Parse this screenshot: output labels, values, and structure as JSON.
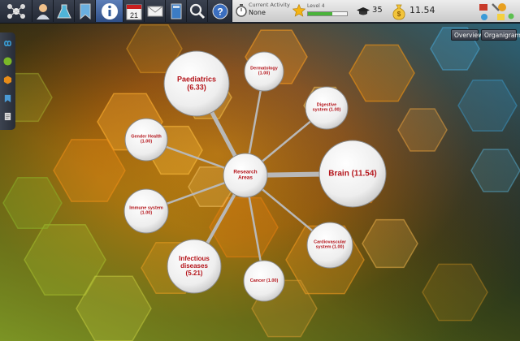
{
  "toolbar": {
    "buttons": [
      {
        "name": "network-icon"
      },
      {
        "name": "profile-icon"
      },
      {
        "name": "lab-flask-icon"
      },
      {
        "name": "bookmark-icon"
      },
      {
        "name": "info-icon"
      },
      {
        "name": "calendar-icon",
        "label": "21"
      },
      {
        "name": "mail-icon"
      },
      {
        "name": "book-icon"
      },
      {
        "name": "search-icon"
      },
      {
        "name": "help-icon"
      }
    ]
  },
  "status": {
    "activity_label": "Current Activity",
    "activity_value": "None",
    "level_label": "Level 4",
    "level_progress": 0.62,
    "graduates": "35",
    "money": "11.54"
  },
  "view_buttons": {
    "overview": "Overview",
    "organigram": "Organigram"
  },
  "graph": {
    "center": {
      "id": "research-areas",
      "label": "Research Areas"
    },
    "nodes": [
      {
        "id": "paediatrics",
        "label": "Paediatrics (6.33)",
        "value": 6.33
      },
      {
        "id": "dermatology",
        "label": "Dermatology (1.00)",
        "value": 1.0
      },
      {
        "id": "digestive-system",
        "label": "Digestive system (1.00)",
        "value": 1.0
      },
      {
        "id": "brain",
        "label": "Brain (11.54)",
        "value": 11.54
      },
      {
        "id": "cardiovascular-system",
        "label": "Cardiovascular system (1.00)",
        "value": 1.0
      },
      {
        "id": "cancer",
        "label": "Cancer (1.00)",
        "value": 1.0
      },
      {
        "id": "infectious-diseases",
        "label": "Infectious diseases (5.21)",
        "value": 5.21
      },
      {
        "id": "immune-system",
        "label": "Immune system (1.00)",
        "value": 1.0
      },
      {
        "id": "gender-health",
        "label": "Gender Health (1.00)",
        "value": 1.0
      }
    ]
  },
  "colors": {
    "node_label": "#b4141a",
    "link": "#b8b8b8",
    "level_fill": "#4ab43a"
  }
}
